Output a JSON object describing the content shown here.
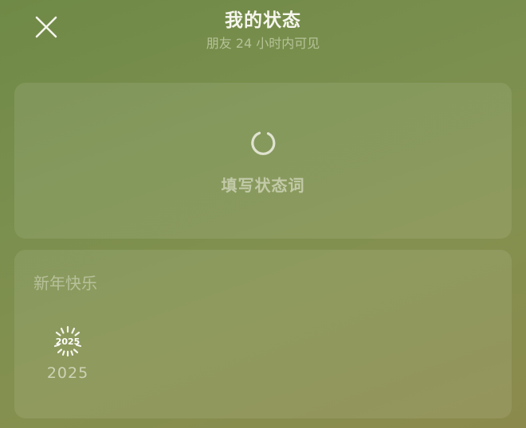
{
  "header": {
    "title": "我的状态",
    "subtitle": "朋友 24 小时内可见",
    "close_icon": "close-icon"
  },
  "status_card": {
    "icon": "loading-ring-icon",
    "prompt": "填写状态词"
  },
  "newyear_section": {
    "title": "新年快乐",
    "items": [
      {
        "icon": "firework-2025-icon",
        "label": "2025"
      }
    ]
  },
  "colors": {
    "background_top": "#6f8946",
    "background_bottom": "#8b8a4c",
    "text_primary": "#f6f6ee"
  }
}
